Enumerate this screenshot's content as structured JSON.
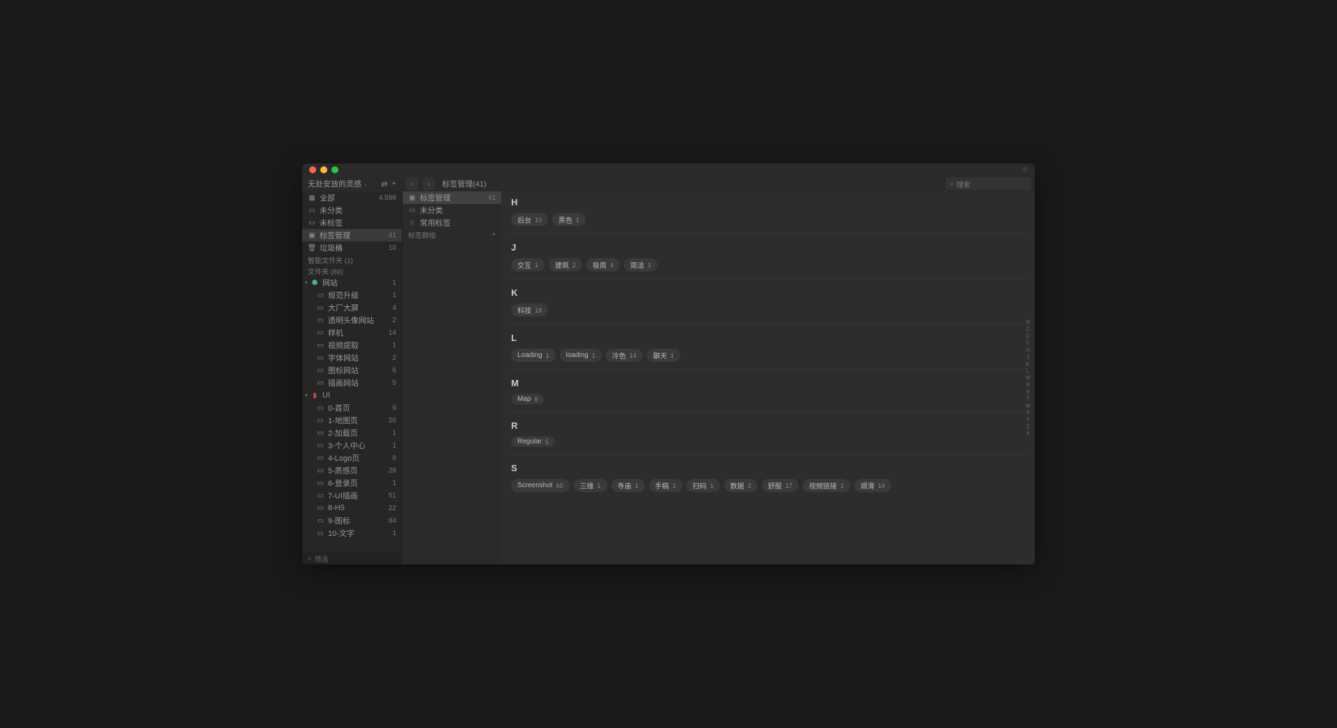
{
  "workspace": "无处安放的灵感",
  "breadcrumb": "标签管理(41)",
  "search_placeholder": "搜索",
  "filter_placeholder": "筛选",
  "col1": {
    "top": [
      {
        "icon": "▦",
        "label": "全部",
        "count": "4,586"
      },
      {
        "icon": "▭",
        "label": "未分类",
        "count": ""
      },
      {
        "icon": "▭",
        "label": "未标签",
        "count": ""
      },
      {
        "icon": "▣",
        "label": "标签管理",
        "count": "41",
        "sel": true
      },
      {
        "icon": "🗑",
        "label": "垃圾桶",
        "count": "10"
      }
    ],
    "smart_label": "智能文件夹 (1)",
    "folders_label": "文件夹 (89)",
    "tree": [
      {
        "type": "parent",
        "icon": "⬢",
        "label": "网站",
        "count": "1",
        "color": "#5a8"
      },
      {
        "type": "child",
        "label": "规范升级",
        "count": "1"
      },
      {
        "type": "child",
        "label": "大厂大屏",
        "count": "4"
      },
      {
        "type": "child",
        "label": "透明头像网站",
        "count": "2"
      },
      {
        "type": "child",
        "label": "样机",
        "count": "14"
      },
      {
        "type": "child",
        "label": "视频提取",
        "count": "1"
      },
      {
        "type": "child",
        "label": "字体网站",
        "count": "2"
      },
      {
        "type": "child",
        "label": "图标网站",
        "count": "6"
      },
      {
        "type": "child",
        "label": "插画网站",
        "count": "5"
      },
      {
        "type": "parent",
        "icon": "▮",
        "label": "UI",
        "count": "",
        "color": "#c44"
      },
      {
        "type": "child",
        "label": "0-首页",
        "count": "9"
      },
      {
        "type": "child",
        "label": "1-地图页",
        "count": "26"
      },
      {
        "type": "child",
        "label": "2-加载页",
        "count": "1"
      },
      {
        "type": "child",
        "label": "3-个人中心",
        "count": "1"
      },
      {
        "type": "child",
        "label": "4-Logo页",
        "count": "8"
      },
      {
        "type": "child",
        "label": "5-质感页",
        "count": "28"
      },
      {
        "type": "child",
        "label": "6-登录页",
        "count": "1"
      },
      {
        "type": "child",
        "label": "7-UI插画",
        "count": "51"
      },
      {
        "type": "child",
        "label": "8-H5",
        "count": "22"
      },
      {
        "type": "child",
        "label": "9-图标",
        "count": "84"
      },
      {
        "type": "child",
        "label": "10-文字",
        "count": "1"
      }
    ]
  },
  "col2": {
    "items": [
      {
        "icon": "▣",
        "label": "标签管理",
        "count": "41",
        "sel": true
      },
      {
        "icon": "▭",
        "label": "未分类",
        "count": ""
      },
      {
        "icon": "☆",
        "label": "常用标签",
        "count": ""
      }
    ],
    "group_label": "标签群组"
  },
  "tag_groups": [
    {
      "letter": "H",
      "tags": [
        {
          "name": "后台",
          "n": "10"
        },
        {
          "name": "黑色",
          "n": "1"
        }
      ]
    },
    {
      "letter": "J",
      "tags": [
        {
          "name": "交互",
          "n": "1"
        },
        {
          "name": "建筑",
          "n": "2"
        },
        {
          "name": "极简",
          "n": "4"
        },
        {
          "name": "简洁",
          "n": "1"
        }
      ]
    },
    {
      "letter": "K",
      "tags": [
        {
          "name": "科技",
          "n": "18"
        }
      ]
    },
    {
      "letter": "L",
      "tags": [
        {
          "name": "Loading",
          "n": "1"
        },
        {
          "name": "loading",
          "n": "1"
        },
        {
          "name": "冷色",
          "n": "14"
        },
        {
          "name": "聊天",
          "n": "1"
        }
      ]
    },
    {
      "letter": "M",
      "tags": [
        {
          "name": "Map",
          "n": "9"
        }
      ]
    },
    {
      "letter": "R",
      "tags": [
        {
          "name": "Regular",
          "n": "5"
        }
      ]
    },
    {
      "letter": "S",
      "tags": [
        {
          "name": "Screenshot",
          "n": "60"
        },
        {
          "name": "三维",
          "n": "1"
        },
        {
          "name": "寺庙",
          "n": "1"
        },
        {
          "name": "手稿",
          "n": "1"
        },
        {
          "name": "扫码",
          "n": "1"
        },
        {
          "name": "数据",
          "n": "2"
        },
        {
          "name": "舒服",
          "n": "17"
        },
        {
          "name": "视频链接",
          "n": "1"
        },
        {
          "name": "顺滑",
          "n": "14"
        }
      ]
    }
  ],
  "alpha": [
    "B",
    "C",
    "D",
    "F",
    "H",
    "J",
    "K",
    "L",
    "M",
    "R",
    "S",
    "T",
    "W",
    "X",
    "Y",
    "Z",
    "#"
  ]
}
